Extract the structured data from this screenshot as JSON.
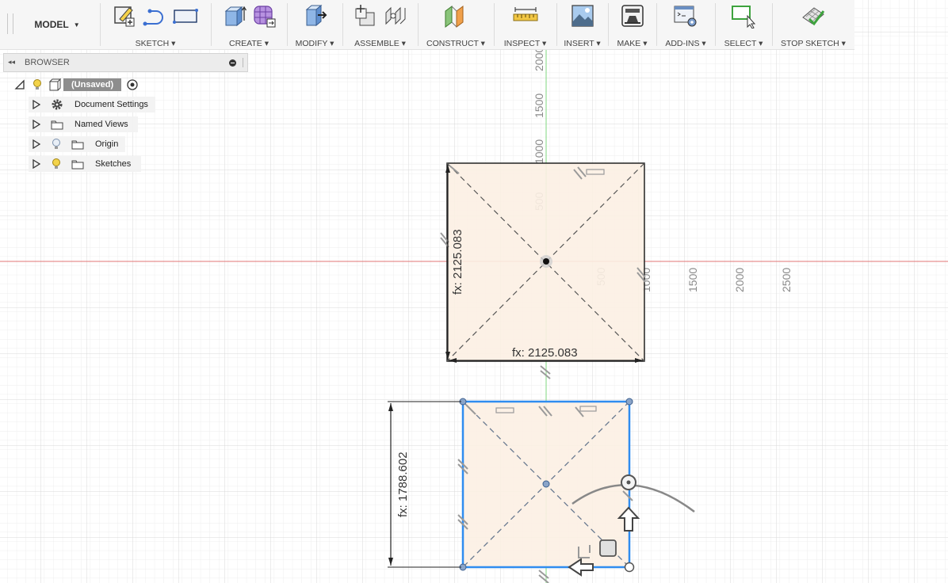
{
  "toolbar": {
    "model_label": "MODEL",
    "groups": [
      {
        "label": "SKETCH ▾"
      },
      {
        "label": "CREATE ▾"
      },
      {
        "label": "MODIFY ▾"
      },
      {
        "label": "ASSEMBLE ▾"
      },
      {
        "label": "CONSTRUCT ▾"
      },
      {
        "label": "INSPECT ▾"
      },
      {
        "label": "INSERT ▾"
      },
      {
        "label": "MAKE ▾"
      },
      {
        "label": "ADD-INS ▾"
      },
      {
        "label": "SELECT ▾"
      },
      {
        "label": "STOP SKETCH ▾"
      }
    ]
  },
  "browser": {
    "title": "BROWSER",
    "root_label": "(Unsaved)",
    "items": [
      {
        "label": "Document Settings",
        "icon": "gear-icon"
      },
      {
        "label": "Named Views",
        "icon": "folder-icon"
      },
      {
        "label": "Origin",
        "icon": "folder-icon"
      },
      {
        "label": "Sketches",
        "icon": "folder-icon"
      }
    ]
  },
  "canvas": {
    "axis_ticks_y": [
      "2000",
      "1500",
      "1000",
      "500"
    ],
    "axis_ticks_x": [
      "500",
      "1000",
      "1500",
      "2000",
      "2500"
    ],
    "dim_top_vertical": "fx: 2125.083",
    "dim_top_horizontal": "fx: 2125.083",
    "dim_bottom_vertical": "fx: 1788.602"
  },
  "colors": {
    "x_axis": "#e07474",
    "y_axis": "#7fd77f",
    "profile_fill": "#fcefe3",
    "selected": "#2f8cf0"
  }
}
